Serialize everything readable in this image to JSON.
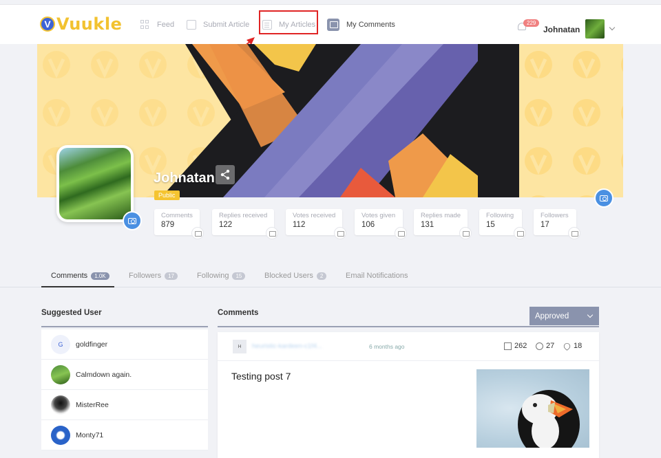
{
  "brand": {
    "logo_letter": "V",
    "logo_text": "Vuukle"
  },
  "nav": {
    "feed": "Feed",
    "submit_article": "Submit Article",
    "my_articles": "My Articles",
    "my_comments": "My Comments"
  },
  "header": {
    "notification_count": "229",
    "user_name": "Johnatan"
  },
  "profile": {
    "name": "Johnatan",
    "visibility": "Public"
  },
  "stats": [
    {
      "label": "Comments",
      "value": "879"
    },
    {
      "label": "Replies received",
      "value": "122"
    },
    {
      "label": "Votes received",
      "value": "112"
    },
    {
      "label": "Votes given",
      "value": "106"
    },
    {
      "label": "Replies made",
      "value": "131"
    },
    {
      "label": "Following",
      "value": "15"
    },
    {
      "label": "Followers",
      "value": "17"
    }
  ],
  "tabs": [
    {
      "label": "Comments",
      "count": "1.0K"
    },
    {
      "label": "Followers",
      "count": "17"
    },
    {
      "label": "Following",
      "count": "15"
    },
    {
      "label": "Blocked Users",
      "count": "2"
    },
    {
      "label": "Email Notifications",
      "count": ""
    }
  ],
  "suggested": {
    "title": "Suggested User",
    "users": [
      {
        "name": "goldfinger",
        "initial": "G"
      },
      {
        "name": "Calmdown again.",
        "initial": ""
      },
      {
        "name": "MisterRee",
        "initial": ""
      },
      {
        "name": "Monty71",
        "initial": ""
      }
    ]
  },
  "comments": {
    "title": "Comments",
    "filter": "Approved",
    "card": {
      "avatar_initial": "H",
      "user": "heuristic-kardeen-c1f4...",
      "time": "6 months ago",
      "replies": "262",
      "reactions": "27",
      "likes": "18",
      "post_title": "Testing post 7"
    }
  },
  "colors": {
    "accent": "#8a93ad",
    "brand_yellow": "#f2c230",
    "highlight": "#e02424"
  }
}
